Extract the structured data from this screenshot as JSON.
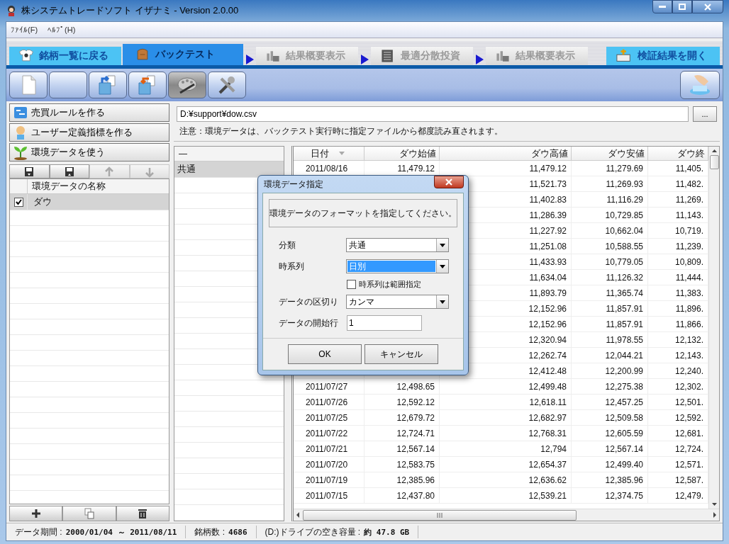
{
  "window": {
    "title": "株システムトレードソフト イザナミ - Version 2.0.00"
  },
  "menu": [
    "ﾌｧｲﾙ(F)",
    "ﾍﾙﾌﾟ(H)"
  ],
  "tabs": [
    {
      "label": "銘柄一覧に戻る",
      "kind": "nav",
      "selected": false,
      "disabled": false
    },
    {
      "label": "バックテスト",
      "kind": "nav",
      "selected": true,
      "disabled": false
    },
    {
      "label": "結果概要表示",
      "kind": "step",
      "selected": false,
      "disabled": true
    },
    {
      "label": "最適分散投資",
      "kind": "step",
      "selected": false,
      "disabled": true
    },
    {
      "label": "結果概要表示",
      "kind": "step",
      "selected": false,
      "disabled": true
    }
  ],
  "open_button": {
    "label": "検証結果を開く"
  },
  "toolbar": [
    {
      "pressed": false
    },
    {
      "pressed": false
    },
    {
      "pressed": false
    },
    {
      "pressed": false
    },
    {
      "pressed": true
    },
    {
      "pressed": false
    }
  ],
  "sidebar": {
    "items": [
      {
        "label": "売買ルールを作る"
      },
      {
        "label": "ユーザー定義指標を作る"
      },
      {
        "label": "環境データを使う"
      }
    ]
  },
  "list_tools": [
    {
      "disabled": false
    },
    {
      "disabled": false
    },
    {
      "disabled": true
    },
    {
      "disabled": true
    }
  ],
  "data_list": {
    "column": "環境データの名称",
    "rows": [
      {
        "name": "ダウ",
        "checked": true,
        "selected": true
      }
    ]
  },
  "path": {
    "value": "D:¥support¥dow.csv"
  },
  "browse_button": "...",
  "note": "注意：環境データは、バックテスト実行時に指定ファイルから都度読み直されます。",
  "category_list": {
    "column": "—",
    "rows": [
      {
        "name": "共通",
        "selected": true
      }
    ]
  },
  "table": {
    "columns": [
      "日付",
      "ダウ始値",
      "ダウ高値",
      "ダウ安値",
      "ダウ終"
    ],
    "rows": [
      {
        "date": "2011/08/16",
        "open": "11,479.12",
        "high": "11,479.12",
        "low": "11,279.69",
        "close": "11,405."
      },
      {
        "high": "11,521.73",
        "low": "11,269.93",
        "close": "11,482."
      },
      {
        "high": "11,402.83",
        "low": "11,116.29",
        "close": "11,269."
      },
      {
        "high": "11,286.39",
        "low": "10,729.85",
        "close": "11,143."
      },
      {
        "high": "11,227.92",
        "low": "10,662.04",
        "close": "10,719."
      },
      {
        "high": "11,251.08",
        "low": "10,588.55",
        "close": "11,239."
      },
      {
        "high": "11,433.93",
        "low": "10,779.05",
        "close": "10,809."
      },
      {
        "high": "11,634.04",
        "low": "11,126.32",
        "close": "11,444."
      },
      {
        "high": "11,893.79",
        "low": "11,365.74",
        "close": "11,383."
      },
      {
        "high": "12,152.96",
        "low": "11,857.91",
        "close": "11,896."
      },
      {
        "high": "12,152.96",
        "low": "11,857.91",
        "close": "11,866."
      },
      {
        "high": "12,320.94",
        "low": "11,978.55",
        "close": "12,132."
      },
      {
        "high": "12,262.74",
        "low": "12,044.21",
        "close": "12,143."
      },
      {
        "high": "12,412.48",
        "low": "12,200.99",
        "close": "12,240."
      },
      {
        "date": "2011/07/27",
        "open": "12,498.65",
        "high": "12,499.48",
        "low": "12,275.38",
        "close": "12,302."
      },
      {
        "date": "2011/07/26",
        "open": "12,592.12",
        "high": "12,618.11",
        "low": "12,457.25",
        "close": "12,501."
      },
      {
        "date": "2011/07/25",
        "open": "12,679.72",
        "high": "12,682.97",
        "low": "12,509.58",
        "close": "12,592."
      },
      {
        "date": "2011/07/22",
        "open": "12,724.71",
        "high": "12,768.31",
        "low": "12,605.59",
        "close": "12,681."
      },
      {
        "date": "2011/07/21",
        "open": "12,567.14",
        "high": "12,794",
        "low": "12,567.14",
        "close": "12,724."
      },
      {
        "date": "2011/07/20",
        "open": "12,583.75",
        "high": "12,654.37",
        "low": "12,499.40",
        "close": "12,571."
      },
      {
        "date": "2011/07/19",
        "open": "12,385.96",
        "high": "12,636.62",
        "low": "12,385.96",
        "close": "12,587."
      },
      {
        "date": "2011/07/15",
        "open": "12,437.80",
        "high": "12,539.21",
        "low": "12,374.75",
        "close": "12,479."
      }
    ]
  },
  "dialog": {
    "title": "環境データ指定",
    "message": "環境データのフォーマットを指定してください。",
    "fields": [
      {
        "label": "分類",
        "kind": "select",
        "value": "共通",
        "focused": false
      },
      {
        "label": "時系列",
        "kind": "select",
        "value": "日別",
        "focused": true
      },
      {
        "label": "時系列は範囲指定",
        "kind": "checkbox",
        "checked": false
      },
      {
        "label": "データの区切り",
        "kind": "select",
        "value": "カンマ",
        "focused": false
      },
      {
        "label": "データの開始行",
        "kind": "input",
        "value": "1"
      }
    ],
    "buttons": [
      "OK",
      "キャンセル"
    ]
  },
  "status_bar": [
    "データ期間 : **2000/01/04 ～ 2011/08/11**",
    "銘柄数 : **4686**",
    "(D:)ドライブの空き容量 : **約 47.8 GB**"
  ]
}
